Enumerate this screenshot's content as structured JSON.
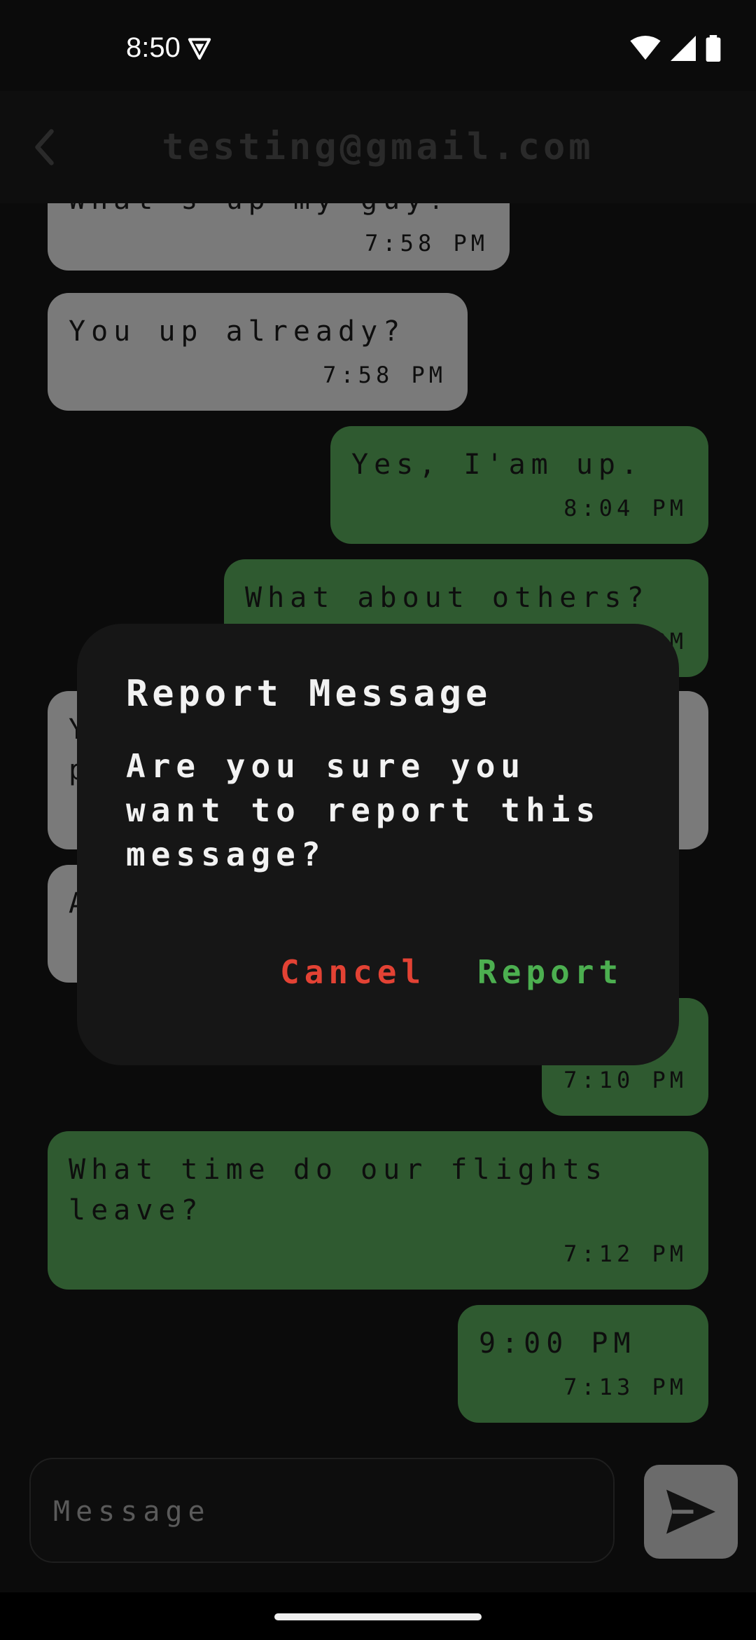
{
  "status": {
    "time": "8:50"
  },
  "appbar": {
    "title": "testing@gmail.com"
  },
  "messages": [
    {
      "dir": "in",
      "text": "What's up my guy?",
      "time": "7:58 PM"
    },
    {
      "dir": "in",
      "text": "You up already?",
      "time": "7:58 PM"
    },
    {
      "dir": "out",
      "text": "Yes, I'am up.",
      "time": "8:04 PM"
    },
    {
      "dir": "out",
      "text": "What about others?",
      "time": "PM"
    },
    {
      "dir": "in",
      "text": "Y\np",
      "time": ""
    },
    {
      "dir": "in",
      "text": "A",
      "time": ""
    },
    {
      "dir": "out",
      "text": "",
      "time": "7:10 PM"
    },
    {
      "dir": "out",
      "text": "What time do our flights\nleave?",
      "time": "7:12 PM"
    },
    {
      "dir": "out",
      "text": "9:00 PM",
      "time": "7:13 PM"
    }
  ],
  "dialog": {
    "title": "Report Message",
    "body": "Are you sure you want to report this message?",
    "cancel_label": "Cancel",
    "confirm_label": "Report"
  },
  "composer": {
    "placeholder": "Message"
  },
  "icons": {
    "back": "back-arrow-icon",
    "send": "send-icon",
    "vpn": "vpn-key-icon",
    "wifi": "wifi-icon",
    "signal": "signal-icon",
    "battery": "battery-icon"
  },
  "colors": {
    "incoming": "#7a7a7a",
    "outgoing": "#2f5a30",
    "cancel": "#e34234",
    "confirm": "#4caf50"
  }
}
